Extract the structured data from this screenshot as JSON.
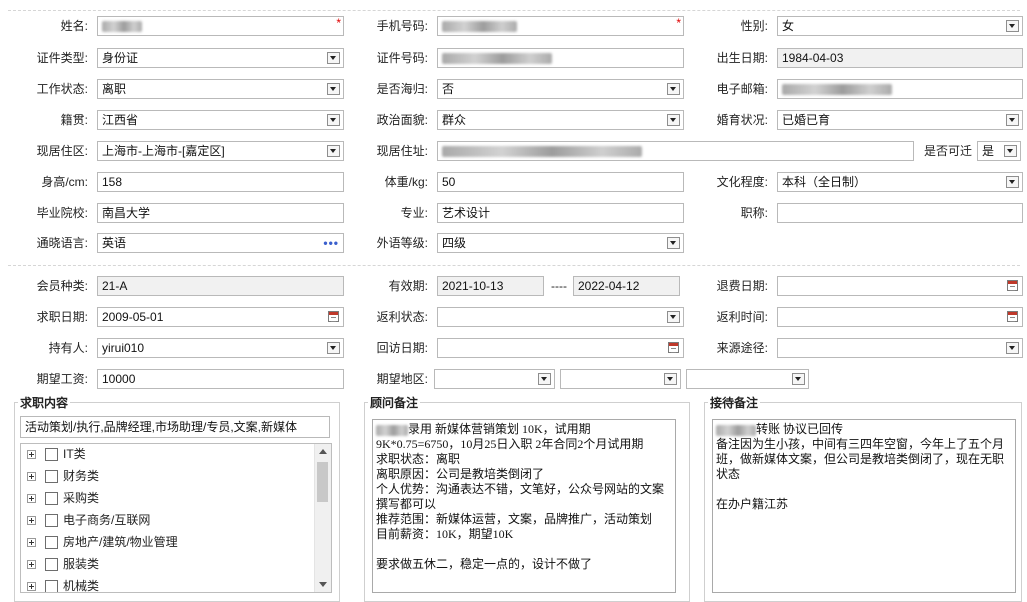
{
  "basic": {
    "name_label": "姓名:",
    "phone_label": "手机号码:",
    "gender_label": "性别:",
    "gender_value": "女",
    "id_type_label": "证件类型:",
    "id_type_value": "身份证",
    "id_no_label": "证件号码:",
    "birth_label": "出生日期:",
    "birth_value": "1984-04-03",
    "work_status_label": "工作状态:",
    "work_status_value": "离职",
    "returnee_label": "是否海归:",
    "returnee_value": "否",
    "email_label": "电子邮箱:",
    "native_label": "籍贯:",
    "native_value": "江西省",
    "political_label": "政治面貌:",
    "political_value": "群众",
    "marital_label": "婚育状况:",
    "marital_value": "已婚已育",
    "residence_area_label": "现居住区:",
    "residence_area_value": "上海市-上海市-[嘉定区]",
    "address_label": "现居住址:",
    "relocate_label": "是否可迁",
    "relocate_value": "是",
    "height_label": "身高/cm:",
    "height_value": "158",
    "weight_label": "体重/kg:",
    "weight_value": "50",
    "education_label": "文化程度:",
    "education_value": "本科（全日制）",
    "school_label": "毕业院校:",
    "school_value": "南昌大学",
    "major_label": "专业:",
    "major_value": "艺术设计",
    "title_label": "职称:",
    "title_value": "",
    "language_label": "通晓语言:",
    "language_value": "英语",
    "language_btn": "•••",
    "lang_level_label": "外语等级:",
    "lang_level_value": "四级"
  },
  "member": {
    "type_label": "会员种类:",
    "type_value": "21-A",
    "valid_label": "有效期:",
    "valid_from": "2021-10-13",
    "valid_sep": "----",
    "valid_to": "2022-04-12",
    "refund_date_label": "退费日期:",
    "job_date_label": "求职日期:",
    "job_date_value": "2009-05-01",
    "rebate_status_label": "返利状态:",
    "rebate_time_label": "返利时间:",
    "holder_label": "持有人:",
    "holder_value": "yirui010",
    "visit_date_label": "回访日期:",
    "source_label": "来源途径:",
    "salary_label": "期望工资:",
    "salary_value": "10000",
    "area_label": "期望地区:"
  },
  "job_content": {
    "title": "求职内容",
    "summary": "活动策划/执行,品牌经理,市场助理/专员,文案,新媒体",
    "tree": [
      "IT类",
      "财务类",
      "采购类",
      "电子商务/互联网",
      "房地产/建筑/物业管理",
      "服装类",
      "机械类"
    ]
  },
  "advisor_notes": {
    "title": "顾问备注",
    "text": "录用 新媒体营销策划 10K，试用期\n9K*0.75=6750，10月25日入职 2年合同2个月试用期\n求职状态：离职\n离职原因：公司是教培类倒闭了\n个人优势：沟通表达不错，文笔好，公众号网站的文案撰写都可以\n推荐范围：新媒体运营，文案，品牌推广，活动策划\n目前薪资：10K，期望10K\n\n要求做五休二，稳定一点的，设计不做了"
  },
  "reception_notes": {
    "title": "接待备注",
    "text": "转账 协议已回传\n备注因为生小孩，中间有三四年空窗，今年上了五个月班，做新媒体文案，但公司是教培类倒闭了，现在无职状态\n\n在办户籍江苏"
  },
  "icons": {
    "dropdown": "chevron-down-icon",
    "calendar": "calendar-icon",
    "expand": "plus-box-icon",
    "checkbox": "checkbox-icon",
    "more": "ellipsis-icon",
    "required": "asterisk-icon"
  },
  "colors": {
    "required": "#e00000",
    "readonly_bg": "#f1f1f1",
    "field_border": "#b9b9b9",
    "ellipsis": "#3a5fcd"
  }
}
